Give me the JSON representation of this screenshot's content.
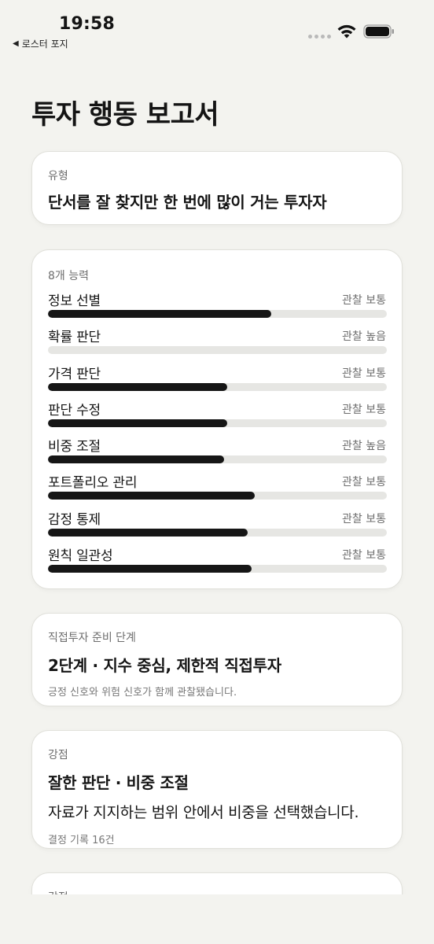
{
  "status_bar": {
    "time": "19:58",
    "back_label": "로스터 포지"
  },
  "page": {
    "title": "투자 행동 보고서"
  },
  "type_card": {
    "label": "유형",
    "value": "단서를 잘 찾지만 한 번에 많이 거는 투자자"
  },
  "ability_card": {
    "label": "8개 능력",
    "abilities": [
      {
        "name": "정보 선별",
        "status": "관찰 보통",
        "level": 0.66
      },
      {
        "name": "확률 판단",
        "status": "관찰 높음",
        "level": 0.0
      },
      {
        "name": "가격 판단",
        "status": "관찰 보통",
        "level": 0.53
      },
      {
        "name": "판단 수정",
        "status": "관찰 보통",
        "level": 0.53
      },
      {
        "name": "비중 조절",
        "status": "관찰 높음",
        "level": 0.52
      },
      {
        "name": "포트폴리오 관리",
        "status": "관찰 보통",
        "level": 0.61
      },
      {
        "name": "감정 통제",
        "status": "관찰 보통",
        "level": 0.59
      },
      {
        "name": "원칙 일관성",
        "status": "관찰 보통",
        "level": 0.6
      }
    ]
  },
  "readiness_card": {
    "label": "직접투자 준비 단계",
    "value": "2단계 · 지수 중심, 제한적 직접투자",
    "note": "긍정 신호와 위험 신호가 함께 관찰됐습니다."
  },
  "strength_card": {
    "label": "강점",
    "value": "잘한 판단 · 비중 조절",
    "description": "자료가 지지하는 범위 안에서 비중을 선택했습니다.",
    "note": "결정 기록 16건"
  },
  "next_card": {
    "label": "강점"
  },
  "colors": {
    "background": "#f3f3ef",
    "bar_fill": "#161616",
    "bar_track": "#e6e6e3"
  }
}
